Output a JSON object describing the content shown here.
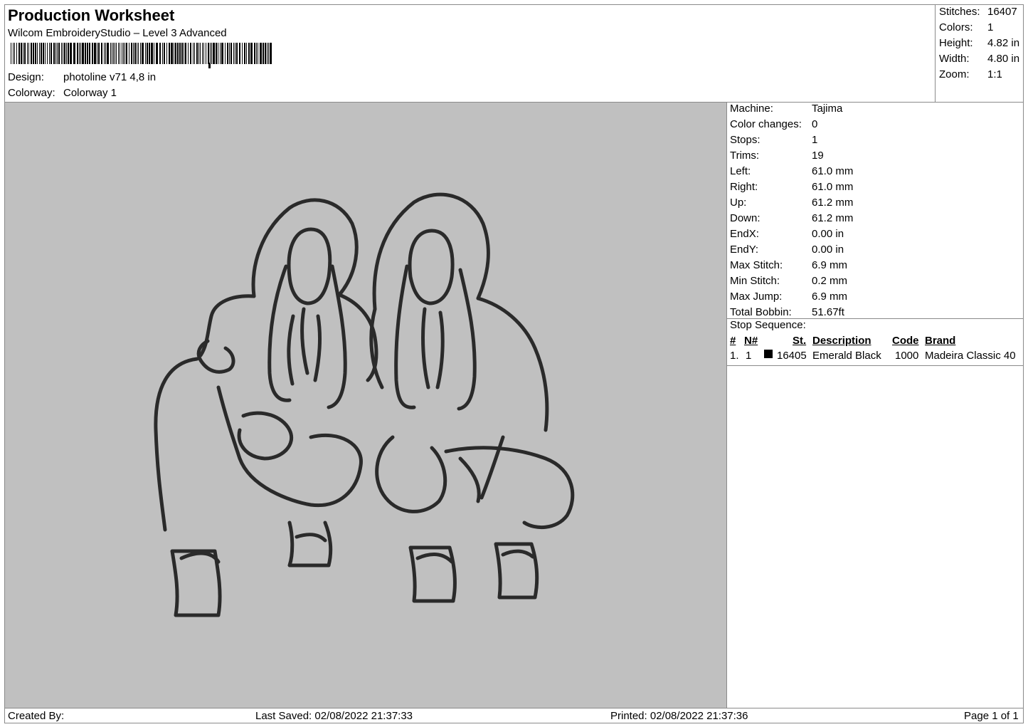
{
  "header": {
    "title": "Production Worksheet",
    "software": "Wilcom EmbroideryStudio – Level 3 Advanced",
    "design_label": "Design:",
    "design_value": "photoline v71 4,8 in",
    "colorway_label": "Colorway:",
    "colorway_value": "Colorway 1"
  },
  "summary": {
    "stitches_label": "Stitches:",
    "stitches": "16407",
    "colors_label": "Colors:",
    "colors": "1",
    "height_label": "Height:",
    "height": "4.82 in",
    "width_label": "Width:",
    "width": "4.80 in",
    "zoom_label": "Zoom:",
    "zoom": "1:1"
  },
  "machine_info": [
    {
      "label": "Machine:",
      "value": "Tajima"
    },
    {
      "label": "Color changes:",
      "value": "0"
    },
    {
      "label": "Stops:",
      "value": "1"
    },
    {
      "label": "Trims:",
      "value": "19"
    },
    {
      "label": "Left:",
      "value": "61.0 mm"
    },
    {
      "label": "Right:",
      "value": "61.0 mm"
    },
    {
      "label": "Up:",
      "value": "61.2 mm"
    },
    {
      "label": "Down:",
      "value": "61.2 mm"
    },
    {
      "label": "EndX:",
      "value": "0.00 in"
    },
    {
      "label": "EndY:",
      "value": "0.00 in"
    },
    {
      "label": "Max Stitch:",
      "value": "6.9 mm"
    },
    {
      "label": "Min Stitch:",
      "value": "0.2 mm"
    },
    {
      "label": "Max Jump:",
      "value": "6.9 mm"
    },
    {
      "label": "Total Bobbin:",
      "value": "51.67ft"
    }
  ],
  "stop_sequence": {
    "label": "Stop Sequence:",
    "headers": [
      "#",
      "N#",
      "St.",
      "Description",
      "Code",
      "Brand"
    ],
    "rows": [
      {
        "index": "1.",
        "needle": "1",
        "stitches": "16405",
        "description": "Emerald Black",
        "code": "1000",
        "brand": "Madeira Classic 40",
        "color": "#000000"
      }
    ]
  },
  "footer": {
    "created_by": "Created By:",
    "last_saved": "Last Saved: 02/08/2022 21:37:33",
    "printed": "Printed: 02/08/2022 21:37:36",
    "page": "Page 1 of 1"
  },
  "colors": {
    "design_background": "#c0c0c0",
    "stitch_color": "#2a2a2a",
    "border": "#8a8a8a"
  }
}
